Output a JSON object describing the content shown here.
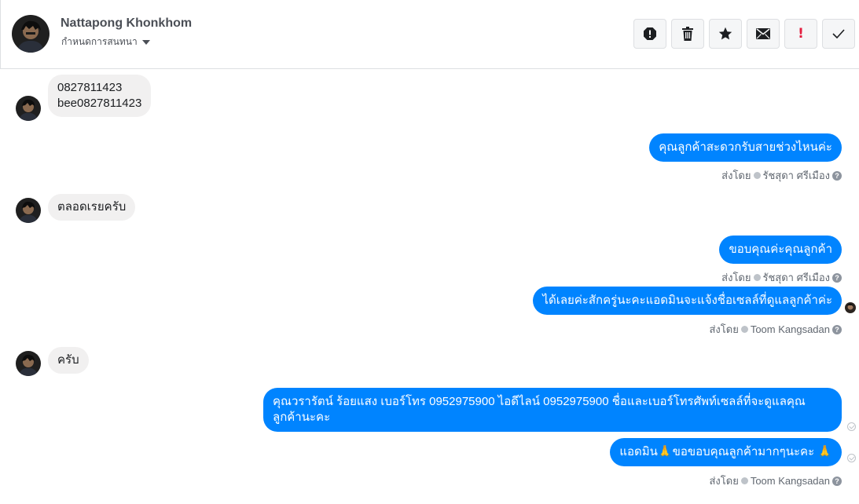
{
  "header": {
    "name": "Nattapong Khonkhom",
    "subtitle": "กำหนดการสนทนา"
  },
  "toolbar": {
    "icons": [
      "alert-icon",
      "trash-icon",
      "star-icon",
      "mail-icon",
      "exclamation-icon",
      "check-icon"
    ],
    "mark_label": "!"
  },
  "messages": [
    {
      "from": "customer",
      "lines": [
        "0827811423",
        "bee0827811423"
      ]
    },
    {
      "from": "page",
      "text": "คุณลูกค้าสะดวกรับสายช่วงไหนค่ะ",
      "sent_by_label": "ส่งโดย",
      "sender": "รัชสุดา ศรีเมือง"
    },
    {
      "from": "customer",
      "text": "ตลอดเรยครับ"
    },
    {
      "from": "page",
      "text": "ขอบคุณค่ะคุณลูกค้า",
      "sent_by_label": "ส่งโดย",
      "sender": "รัชสุดา ศรีเมือง"
    },
    {
      "from": "page",
      "text": "ได้เลยค่ะสักครู่นะคะแอดมินจะแจ้งชื่อเซลล์ที่ดูแลลูกค้าค่ะ",
      "sent_by_label": "ส่งโดย",
      "sender": "Toom Kangsadan"
    },
    {
      "from": "customer",
      "text": "ครับ"
    },
    {
      "from": "page",
      "text": "คุณวรารัตน์ ร้อยแสง       เบอร์โทร 0952975900  ไอดีไลน์ 0952975900 ชื่อและเบอร์โทรศัพท์เซลล์ที่จะดูแลคุณลูกค้านะคะ"
    },
    {
      "from": "page",
      "text": "แอดมิน🙏ขอขอบคุณลูกค้ามากๆนะคะ 🙏",
      "sent_by_label": "ส่งโดย",
      "sender": "Toom Kangsadan"
    }
  ],
  "colors": {
    "outgoing": "#0084ff",
    "incoming": "#f1f0f0",
    "divider": "#dddfe2"
  }
}
